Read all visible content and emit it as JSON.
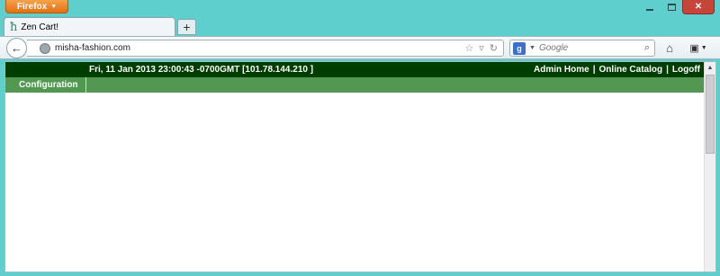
{
  "browser": {
    "app_button_label": "Firefox",
    "tab_title": "Zen Cart!",
    "new_tab_label": "+",
    "url": "misha-fashion.com",
    "search_placeholder": "Google",
    "search_engine_letter": "g"
  },
  "page": {
    "header_datetime": "Fri, 11 Jan 2013 23:00:43 -0700GMT [101.78.144.210 ]",
    "links": [
      "Admin Home",
      "Online Catalog",
      "Logoff"
    ],
    "link_separator": "|",
    "menu": [
      "Configuration"
    ]
  },
  "colors": {
    "header_bg": "#003d00",
    "menu_bg": "#529852",
    "firefox_orange": "#e56f10",
    "frame_teal": "#5fcfcd"
  }
}
